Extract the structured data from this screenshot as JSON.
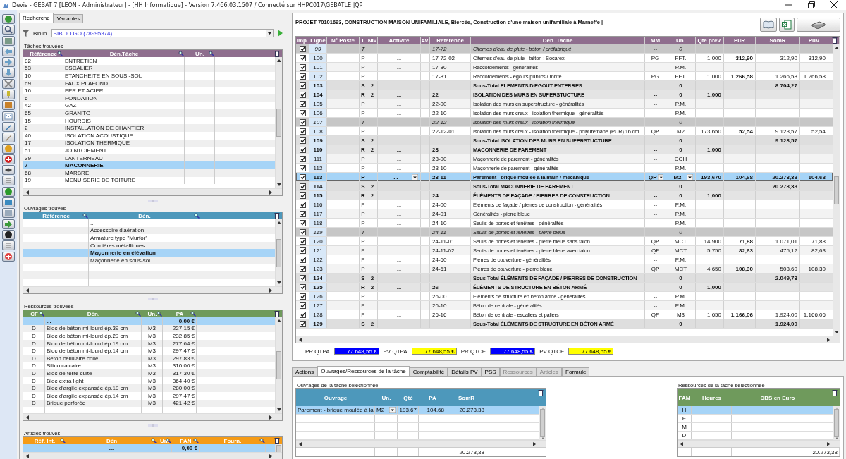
{
  "window": {
    "title": "Devis - GEBAT 7 [LEON - Administrateur] - [HH Informatique]  - Version 7.466.03.1507 / Connecté sur HHPC017\\GEBATLE||QP"
  },
  "search_tabs": [
    {
      "label": "Recherche",
      "selected": true
    },
    {
      "label": "Variables",
      "selected": false
    }
  ],
  "biblio": {
    "label": "Biblio",
    "value": "BIBLIO GO  (78995374)"
  },
  "taches": {
    "title": "Tâches trouvées",
    "columns": [
      "Référence",
      "Dén.Tâche",
      "Un."
    ],
    "rows": [
      {
        "reference": "82",
        "designation": "ENTRETIEN",
        "selected": false
      },
      {
        "reference": "53",
        "designation": "ESCALIER",
        "selected": false
      },
      {
        "reference": "10",
        "designation": "ETANCHEITE EN SOUS -SOL",
        "selected": false
      },
      {
        "reference": "69",
        "designation": "FAUX PLAFOND",
        "selected": false
      },
      {
        "reference": "16",
        "designation": "FER ET ACIER",
        "selected": false
      },
      {
        "reference": "6",
        "designation": "FONDATION",
        "selected": false
      },
      {
        "reference": "42",
        "designation": "GAZ",
        "selected": false
      },
      {
        "reference": "65",
        "designation": "GRANITO",
        "selected": false
      },
      {
        "reference": "15",
        "designation": "HOURDIS",
        "selected": false
      },
      {
        "reference": "2",
        "designation": "INSTALLATION DE CHANTIER",
        "selected": false
      },
      {
        "reference": "40",
        "designation": "ISOLATION ACOUSTIQUE",
        "selected": false
      },
      {
        "reference": "17",
        "designation": "ISOLATION THERMIQUE",
        "selected": false
      },
      {
        "reference": "51",
        "designation": "JOINTOIEMENT",
        "selected": false
      },
      {
        "reference": "39",
        "designation": "LANTERNEAU",
        "selected": false
      },
      {
        "reference": "7",
        "designation": "MACONNERIE",
        "selected": true
      },
      {
        "reference": "68",
        "designation": "MARBRE",
        "selected": false
      },
      {
        "reference": "19",
        "designation": "MENUISERIE DE TOITURE",
        "selected": false
      }
    ]
  },
  "ouvrages": {
    "title": "Ouvrages trouvés",
    "columns": [
      "Référence",
      "Dén."
    ],
    "rows": [
      {
        "designation": "...",
        "selected": false
      },
      {
        "designation": "Accessoire d'aération",
        "selected": false
      },
      {
        "designation": "Armature type \"Murfor\"",
        "selected": false
      },
      {
        "designation": "Cornières métalliques",
        "selected": false
      },
      {
        "designation": "Maçonnerie en élévation",
        "selected": true
      },
      {
        "designation": "Maçonnerie en sous-sol",
        "selected": false
      }
    ]
  },
  "ressources": {
    "title": "Ressources trouvées",
    "columns": [
      "CF",
      "Dén.",
      "Un.",
      "PA"
    ],
    "rows": [
      {
        "designation": "...",
        "pa": "0,00 €",
        "selected": true
      },
      {
        "cf": "D",
        "designation": "Bloc de béton mi-lourd ép.39 cm",
        "un": "M3",
        "pa": "227,15 €",
        "selected": false
      },
      {
        "cf": "D",
        "designation": "Bloc de béton mi-lourd ép.29 cm",
        "un": "M3",
        "pa": "232,85 €",
        "selected": false
      },
      {
        "cf": "D",
        "designation": "Bloc de béton mi-lourd ép.19 cm",
        "un": "M3",
        "pa": "277,64 €",
        "selected": false
      },
      {
        "cf": "D",
        "designation": "Bloc de béton mi-lourd ép.14 cm",
        "un": "M3",
        "pa": "297,47 €",
        "selected": false
      },
      {
        "cf": "D",
        "designation": "Béton cellulaire collé",
        "un": "M3",
        "pa": "297,83 €",
        "selected": false
      },
      {
        "cf": "D",
        "designation": "Silico calcaire",
        "un": "M3",
        "pa": "310,00 €",
        "selected": false
      },
      {
        "cf": "D",
        "designation": "Bloc de terre cuite",
        "un": "M3",
        "pa": "317,30 €",
        "selected": false
      },
      {
        "cf": "D",
        "designation": "Bloc extra light",
        "un": "M3",
        "pa": "364,40 €",
        "selected": false
      },
      {
        "cf": "D",
        "designation": "Bloc d'argile expansée ép.19 cm",
        "un": "M3",
        "pa": "280,00 €",
        "selected": false
      },
      {
        "cf": "D",
        "designation": "Bloc d'argile expansée ép.14 cm",
        "un": "M3",
        "pa": "297,47 €",
        "selected": false
      },
      {
        "cf": "D",
        "designation": "Brique perforée",
        "un": "M3",
        "pa": "421,42 €",
        "selected": false
      }
    ]
  },
  "articles": {
    "title": "Articles trouvés",
    "columns": [
      "Réf. Int.",
      "Dén",
      "Un.",
      "PAN",
      "Fourn."
    ],
    "rows": [
      {
        "designation": "...",
        "pan": "0,00 €",
        "selected": true
      }
    ]
  },
  "project": {
    "title": "PROJET 70101693, CONSTRUCTION MAISON UNIFAMILIALE, Biercée, Construction d'une maison unifamiliale à Marneffe |"
  },
  "devis": {
    "columns": [
      "Imp.",
      "Ligne",
      "N° Poste",
      "T.",
      "Niv",
      "Activité",
      "Av.",
      "Référence",
      "Dén. Tâche",
      "MM",
      "Un.",
      "Qté prév.",
      "PuR",
      "SomR",
      "PuV"
    ],
    "rows": [
      {
        "kind": "title",
        "checked": true,
        "selected": false,
        "ligne": "99",
        "t": "T",
        "reference": "17-72",
        "designation": "Citernes d'eau de pluie - béton / préfabriqué",
        "mm": "--",
        "un": "0"
      },
      {
        "kind": "item",
        "checked": true,
        "selected": false,
        "ligne": "100",
        "t": "P",
        "activite": "...",
        "reference": "17-72-02",
        "designation": "Citernes d'eau de pluie - béton : Socarex",
        "mm": "PG",
        "un": "FFT.",
        "qte": "1,000",
        "pur": "312,90",
        "somr": "312,90",
        "puv": "312,90"
      },
      {
        "kind": "item",
        "checked": true,
        "selected": false,
        "ligne": "101",
        "t": "P",
        "activite": "...",
        "reference": "17-80",
        "designation": "Raccordements - généralités",
        "mm": "--",
        "un": "P.M."
      },
      {
        "kind": "item",
        "checked": true,
        "selected": false,
        "ligne": "102",
        "t": "P",
        "activite": "...",
        "reference": "17-81",
        "designation": "Raccordements - égouts publics / mixte",
        "mm": "PG",
        "un": "FFT.",
        "qte": "1,000",
        "pur": "1.266,58",
        "somr": "1.266,58",
        "puv": "1.266,58"
      },
      {
        "kind": "subtotal",
        "checked": true,
        "selected": false,
        "ligne": "103",
        "t": "S",
        "niv": "2",
        "designation": "Sous-Total ELEMENTS D'EGOUT ENTERRES",
        "un": "0",
        "somr": "8.704,27"
      },
      {
        "kind": "chapter",
        "checked": true,
        "selected": false,
        "ligne": "104",
        "t": "R",
        "niv": "2",
        "activite": "...",
        "reference": "22",
        "designation": "ISOLATION DES MURS EN SUPERSTUCTURE",
        "mm": "--",
        "un": "0",
        "qte": "1,000"
      },
      {
        "kind": "item",
        "checked": true,
        "selected": false,
        "ligne": "105",
        "t": "P",
        "activite": "...",
        "reference": "22-00",
        "designation": "Isolation des murs en superstructure - généralités",
        "mm": "--",
        "un": "P.M."
      },
      {
        "kind": "item",
        "checked": true,
        "selected": false,
        "ligne": "106",
        "t": "P",
        "activite": "...",
        "reference": "22-10",
        "designation": "Isolation des murs creux - isolation thermique - généralités",
        "mm": "--",
        "un": "P.M."
      },
      {
        "kind": "title",
        "checked": true,
        "selected": false,
        "ligne": "107",
        "t": "T",
        "reference": "22-12",
        "designation": "Isolation des murs creux - isolation thermique",
        "mm": "--",
        "un": "0"
      },
      {
        "kind": "item",
        "checked": true,
        "selected": false,
        "ligne": "108",
        "t": "P",
        "activite": "...",
        "reference": "22-12-01",
        "designation": "Isolation des murs creux - isolation thermique - polyuréthane (PUR) 16 cm",
        "mm": "QP",
        "un": "M2",
        "qte": "173,650",
        "pur": "52,54",
        "somr": "9.123,57",
        "puv": "52,54"
      },
      {
        "kind": "subtotal",
        "checked": true,
        "selected": false,
        "ligne": "109",
        "t": "S",
        "niv": "2",
        "designation": "Sous-Total ISOLATION DES MURS EN SUPERSTUCTURE",
        "un": "0",
        "somr": "9.123,57"
      },
      {
        "kind": "chapter",
        "checked": true,
        "selected": false,
        "ligne": "110",
        "t": "R",
        "niv": "2",
        "activite": "...",
        "reference": "23",
        "designation": "MACONNERIE DE PAREMENT",
        "mm": "--",
        "un": "0",
        "qte": "1,000"
      },
      {
        "kind": "item",
        "checked": true,
        "selected": false,
        "ligne": "111",
        "t": "P",
        "activite": "...",
        "reference": "23-00",
        "designation": "Maçonnerie de parement - généralités",
        "mm": "--",
        "un": "CCH"
      },
      {
        "kind": "item",
        "checked": true,
        "selected": false,
        "ligne": "112",
        "t": "P",
        "activite": "...",
        "reference": "23-10",
        "designation": "Maçonnerie de parement - généralités",
        "mm": "--",
        "un": "P.M."
      },
      {
        "kind": "item",
        "checked": true,
        "selected": true,
        "ligne": "113",
        "t": "P",
        "activite": "...",
        "reference": "23-11",
        "designation": "Parement - brique moulée à la main / mécanique",
        "mm": "QP",
        "un": "M2",
        "qte": "193,670",
        "pur": "104,68",
        "somr": "20.273,38",
        "puv": "104,68"
      },
      {
        "kind": "subtotal",
        "checked": true,
        "selected": false,
        "ligne": "114",
        "t": "S",
        "niv": "2",
        "designation": "Sous-Total MACONNERIE DE PAREMENT",
        "un": "0",
        "somr": "20.273,38"
      },
      {
        "kind": "chapter",
        "checked": true,
        "selected": false,
        "ligne": "115",
        "t": "R",
        "niv": "2",
        "activite": "...",
        "reference": "24",
        "designation": "ÉLÉMENTS DE FAÇADE  / PIERRES DE CONSTRUCTION",
        "mm": "--",
        "un": "0",
        "qte": "1,000"
      },
      {
        "kind": "item",
        "checked": true,
        "selected": false,
        "ligne": "116",
        "t": "P",
        "activite": "...",
        "reference": "24-00",
        "designation": "Eléments de façade / pierres de construction - généralités",
        "mm": "--",
        "un": "P.M."
      },
      {
        "kind": "item",
        "checked": true,
        "selected": false,
        "ligne": "117",
        "t": "P",
        "activite": "...",
        "reference": "24-01",
        "designation": "Généralités - pierre bleue",
        "mm": "--",
        "un": "P.M."
      },
      {
        "kind": "item",
        "checked": true,
        "selected": false,
        "ligne": "118",
        "t": "P",
        "activite": "...",
        "reference": "24-10",
        "designation": "Seuils de portes et fenêtres - généralités",
        "mm": "--",
        "un": "P.M."
      },
      {
        "kind": "title",
        "checked": true,
        "selected": false,
        "ligne": "119",
        "t": "T",
        "reference": "24-11",
        "designation": "Seuils de portes et fenêtres - pierre bleue",
        "mm": "--",
        "un": "0"
      },
      {
        "kind": "item",
        "checked": true,
        "selected": false,
        "ligne": "120",
        "t": "P",
        "activite": "...",
        "reference": "24-11-01",
        "designation": "Seuils de portes et fenêtres - pierre bleue sans talon",
        "mm": "QP",
        "un": "MCT",
        "qte": "14,900",
        "pur": "71,88",
        "somr": "1.071,01",
        "puv": "71,88"
      },
      {
        "kind": "item",
        "checked": true,
        "selected": false,
        "ligne": "121",
        "t": "P",
        "activite": "...",
        "reference": "24-11-02",
        "designation": "Seuils de portes et fenêtres - pierre bleue avec talon",
        "mm": "QF",
        "un": "MCT",
        "qte": "5,750",
        "pur": "82,63",
        "somr": "475,12",
        "puv": "82,63"
      },
      {
        "kind": "item",
        "checked": true,
        "selected": false,
        "ligne": "122",
        "t": "P",
        "activite": "...",
        "reference": "24-60",
        "designation": "Pierres de couverture - généralités",
        "mm": "--",
        "un": "P.M."
      },
      {
        "kind": "item",
        "checked": true,
        "selected": false,
        "ligne": "123",
        "t": "P",
        "activite": "...",
        "reference": "24-61",
        "designation": "Pierres de couverture - pierre bleue",
        "mm": "QP",
        "un": "MCT",
        "qte": "4,650",
        "pur": "108,30",
        "somr": "503,60",
        "puv": "108,30"
      },
      {
        "kind": "subtotal",
        "checked": true,
        "selected": false,
        "ligne": "124",
        "t": "S",
        "niv": "2",
        "designation": "Sous-Total ÉLÉMENTS DE FAÇADE  / PIERRES DE CONSTRUCTION",
        "un": "0",
        "somr": "2.049,73"
      },
      {
        "kind": "chapter",
        "checked": true,
        "selected": false,
        "ligne": "125",
        "t": "R",
        "niv": "2",
        "activite": "...",
        "reference": "26",
        "designation": "ÉLÉMENTS DE STRUCTURE EN BÉTON ARMÉ",
        "mm": "--",
        "un": "0",
        "qte": "1,000"
      },
      {
        "kind": "item",
        "checked": true,
        "selected": false,
        "ligne": "126",
        "t": "P",
        "activite": "...",
        "reference": "26-00",
        "designation": "Eléments de structure en béton armé - généralités",
        "mm": "--",
        "un": "P.M."
      },
      {
        "kind": "item",
        "checked": true,
        "selected": false,
        "ligne": "127",
        "t": "P",
        "activite": "...",
        "reference": "26-10",
        "designation": "Béton de centrale - généralités",
        "mm": "--",
        "un": "P.M."
      },
      {
        "kind": "item",
        "checked": true,
        "selected": false,
        "ligne": "128",
        "t": "P",
        "activite": "...",
        "reference": "26-16",
        "designation": "Béton de centrale - escaliers et paliers",
        "mm": "QP",
        "un": "M3",
        "qte": "1,650",
        "pur": "1.166,06",
        "somr": "1.924,00",
        "puv": "1.166,06"
      },
      {
        "kind": "subtotal",
        "checked": true,
        "selected": false,
        "ligne": "129",
        "t": "S",
        "niv": "2",
        "designation": "Sous-Total ÉLÉMENTS DE STRUCTURE EN BÉTON ARMÉ",
        "un": "0",
        "somr": "1.924,00"
      }
    ]
  },
  "totals": [
    {
      "label": "PR QTPA",
      "value": "77.648,55 €",
      "color": "#0000ff"
    },
    {
      "label": "PV QTPA",
      "value": "77.648,55 €",
      "color": "#ffff00"
    },
    {
      "label": "PR QTCE",
      "value": "77.648,55 €",
      "color": "#0000ff"
    },
    {
      "label": "PV QTCE",
      "value": "77.648,55 €",
      "color": "#ffff00"
    }
  ],
  "bottom_tabs": [
    {
      "label": "Actions",
      "selected": false,
      "disabled": false
    },
    {
      "label": "Ouvrages/Ressources de la tâche",
      "selected": true,
      "disabled": false
    },
    {
      "label": "Comptabilité",
      "selected": false,
      "disabled": false
    },
    {
      "label": "Détails PV",
      "selected": false,
      "disabled": false
    },
    {
      "label": "PSS",
      "selected": false,
      "disabled": false
    },
    {
      "label": "Ressources",
      "selected": false,
      "disabled": true
    },
    {
      "label": "Articles",
      "selected": false,
      "disabled": true
    },
    {
      "label": "Formule",
      "selected": false,
      "disabled": false
    }
  ],
  "ouvrages_tache": {
    "title": "Ouvrages de la tâche sélectionnée",
    "columns": [
      "Ouvrage",
      "Un.",
      "Qté",
      "PA",
      "SomR"
    ],
    "rows": [
      {
        "ouvrage": "Parement - brique moulée à la",
        "un": "M2",
        "qte": "193,67",
        "pa": "104,68",
        "somr": "20.273,38",
        "selected": true
      }
    ],
    "total": "20.273,38"
  },
  "ressources_tache": {
    "title": "Ressources de la tâche sélectionnée",
    "columns": [
      "FAM",
      "Heures",
      "DBS en Euro"
    ],
    "rows": [
      {
        "fam": "H",
        "selected": true
      },
      {
        "fam": "E",
        "selected": false
      },
      {
        "fam": "M",
        "selected": false
      },
      {
        "fam": "D",
        "selected": false
      }
    ],
    "total": "20.273,38"
  }
}
